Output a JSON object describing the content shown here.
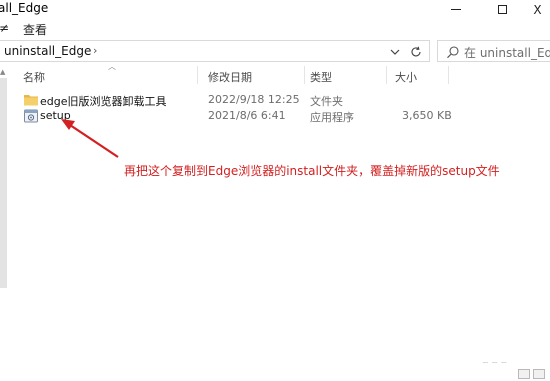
{
  "window": {
    "title": "all_Edge",
    "minimize_icon": "minimize-icon",
    "maximize_icon": "maximize-icon",
    "close_label": "X"
  },
  "ribbon": {
    "tabs": [
      "≠",
      "查看"
    ]
  },
  "address": {
    "path": "uninstall_Edge",
    "chevron": "›",
    "dropdown_icon": "chevron-down-icon",
    "refresh_icon": "refresh-icon"
  },
  "search": {
    "placeholder": "在 uninstall_Edg..."
  },
  "columns": {
    "name": "名称",
    "modified": "修改日期",
    "type": "类型",
    "size": "大小"
  },
  "files": [
    {
      "name": "edge旧版浏览器卸载工具",
      "modified": "2022/9/18 12:25",
      "type": "文件夹",
      "size": "",
      "icon": "folder-icon"
    },
    {
      "name": "setup",
      "modified": "2021/8/6 6:41",
      "type": "应用程序",
      "size": "3,650 KB",
      "icon": "application-icon"
    }
  ],
  "annotation": {
    "text": "再把这个复制到Edge浏览器的install文件夹，覆盖掉新版的setup文件",
    "color": "#d32020"
  },
  "colors": {
    "folder": "#e8b64a",
    "accent": "#0067c0"
  }
}
